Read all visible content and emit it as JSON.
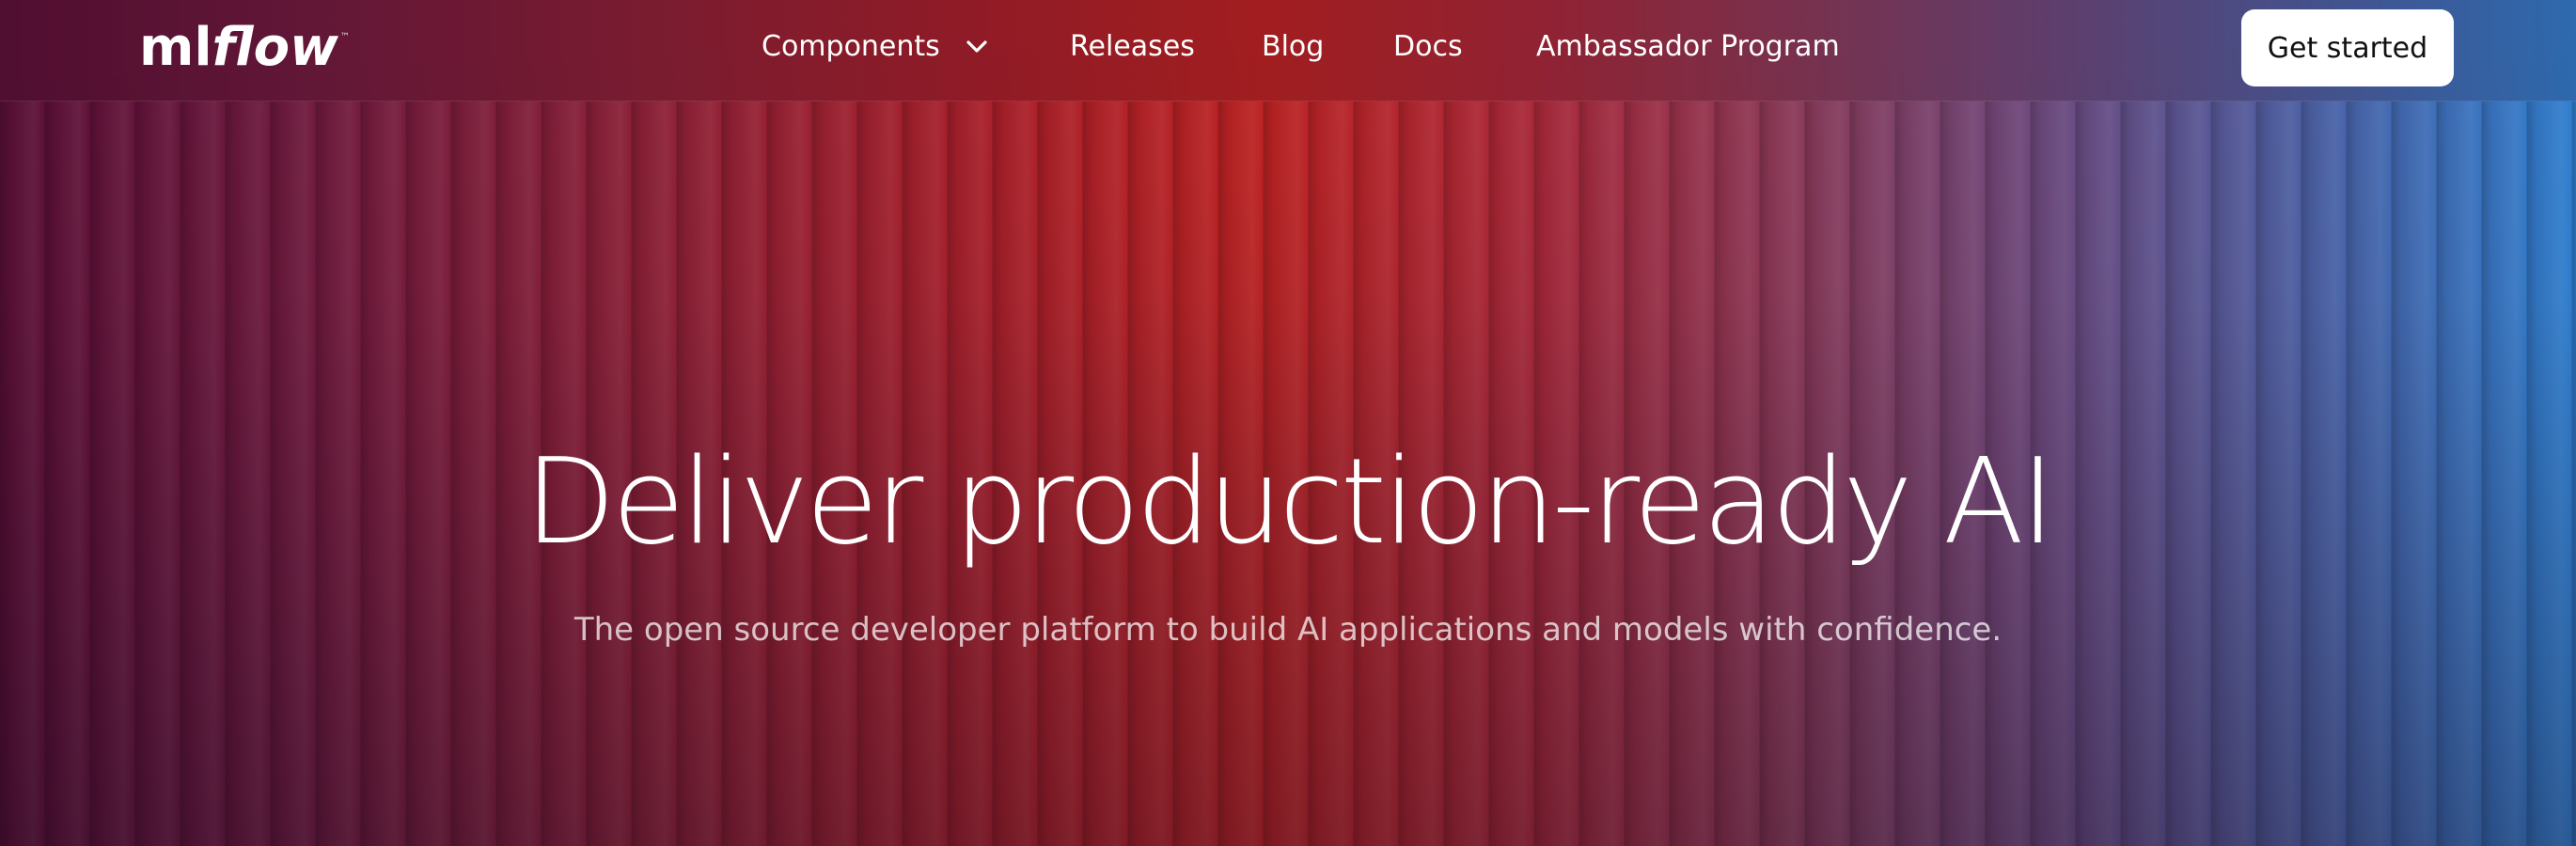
{
  "header": {
    "logo": {
      "ml": "ml",
      "flow": "flow",
      "tm": "™"
    },
    "nav": {
      "components": "Components",
      "releases": "Releases",
      "blog": "Blog",
      "docs": "Docs",
      "ambassador": "Ambassador Program"
    },
    "cta": "Get started"
  },
  "hero": {
    "title": "Deliver production-ready AI",
    "subtitle": "The open source developer platform to build AI applications and models with confidence."
  },
  "colors": {
    "gradient_left": "#5a0f36",
    "gradient_center": "#bd2222",
    "gradient_right": "#2f7fd0",
    "cta_background": "#ffffff",
    "cta_text": "#111111"
  },
  "icons": {
    "components_dropdown": "chevron-down-icon"
  }
}
